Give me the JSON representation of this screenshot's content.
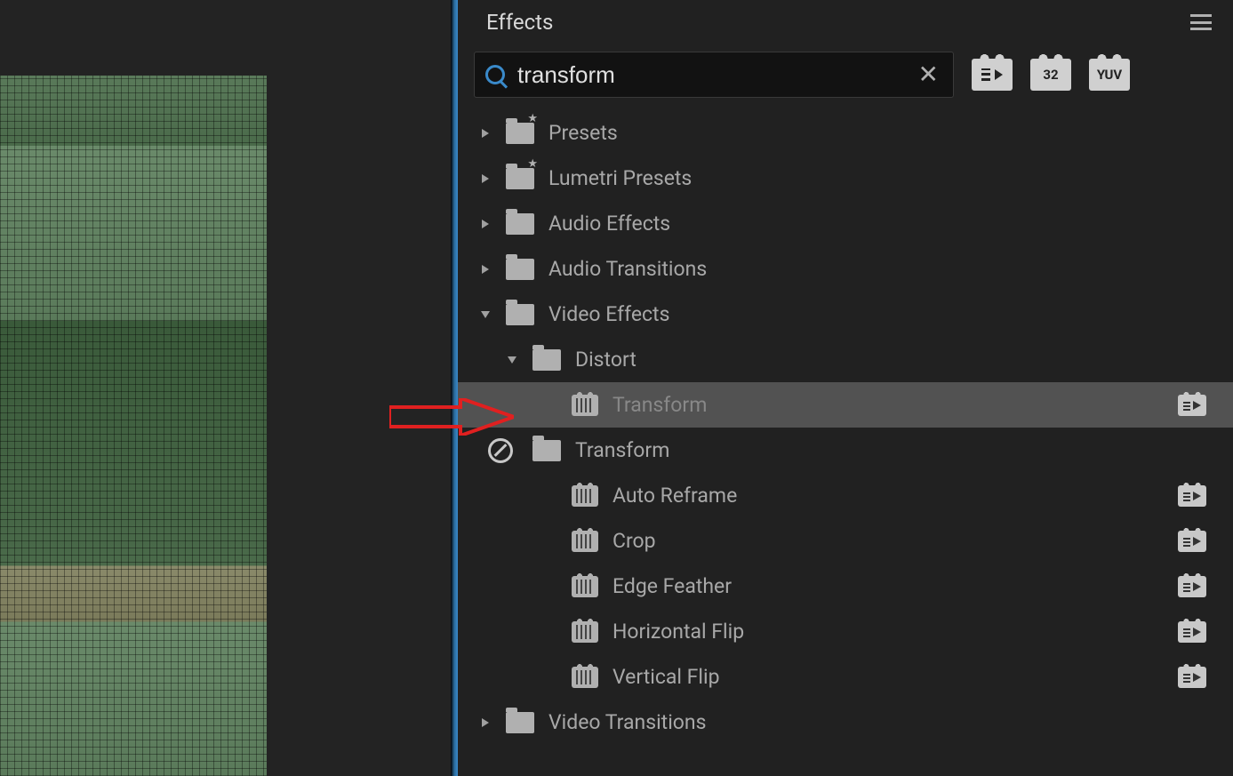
{
  "panel": {
    "title": "Effects"
  },
  "search": {
    "value": "transform"
  },
  "badges": {
    "b2_text": "32",
    "b3_text": "YUV"
  },
  "tree": {
    "presets": "Presets",
    "lumetri": "Lumetri Presets",
    "audio_effects": "Audio Effects",
    "audio_transitions": "Audio Transitions",
    "video_effects": "Video Effects",
    "distort": "Distort",
    "transform_effect": "Transform",
    "transform_folder": "Transform",
    "auto_reframe": "Auto Reframe",
    "crop": "Crop",
    "edge_feather": "Edge Feather",
    "horizontal_flip": "Horizontal Flip",
    "vertical_flip": "Vertical Flip",
    "video_transitions": "Video Transitions"
  }
}
